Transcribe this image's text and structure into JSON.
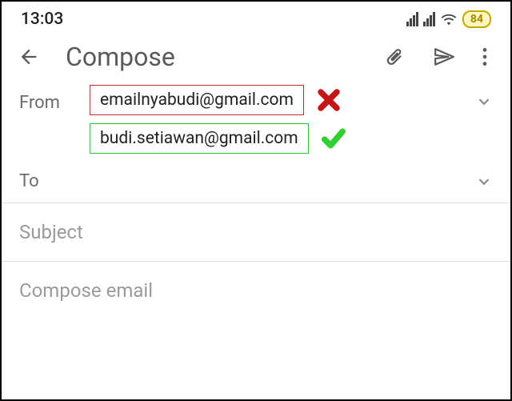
{
  "status_bar": {
    "time": "13:03",
    "battery": "84"
  },
  "toolbar": {
    "title": "Compose"
  },
  "from": {
    "label": "From",
    "email_invalid": "emailnyabudi@gmail.com",
    "email_valid": "budi.setiawan@gmail.com"
  },
  "to": {
    "label": "To"
  },
  "subject": {
    "placeholder": "Subject"
  },
  "body": {
    "placeholder": "Compose email"
  },
  "colors": {
    "invalid": "#c41616",
    "valid": "#2fd02f"
  }
}
